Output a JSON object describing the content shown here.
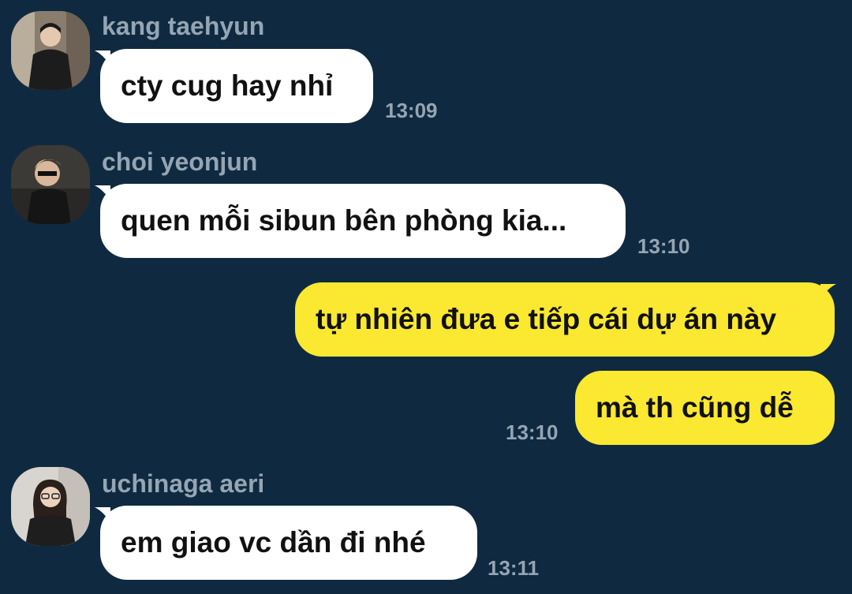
{
  "messages": [
    {
      "direction": "incoming",
      "sender": "kang taehyun",
      "text": "cty cug hay nhỉ",
      "time": "13:09",
      "avatar": "avatar-kang-taehyun"
    },
    {
      "direction": "incoming",
      "sender": "choi yeonjun",
      "text": "quen mỗi sibun bên phòng kia...",
      "time": "13:10",
      "avatar": "avatar-choi-yeonjun"
    },
    {
      "direction": "outgoing",
      "text": "tự nhiên đưa e tiếp cái dự án này"
    },
    {
      "direction": "outgoing",
      "text": "mà th cũng dễ",
      "time": "13:10"
    },
    {
      "direction": "incoming",
      "sender": "uchinaga aeri",
      "text": "em giao vc dần đi nhé",
      "time": "13:11",
      "avatar": "avatar-uchinaga-aeri"
    }
  ],
  "colors": {
    "background": "#0f2a40",
    "incoming_bubble": "#ffffff",
    "outgoing_bubble": "#fae831",
    "meta_text": "#95a5b3"
  }
}
